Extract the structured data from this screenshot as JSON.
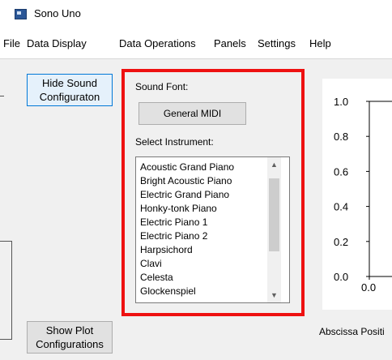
{
  "window": {
    "title": "Sono Uno"
  },
  "menu": [
    "File",
    "Data Display",
    "Data Operations",
    "Panels",
    "Settings",
    "Help"
  ],
  "buttons": {
    "hide_sound": "Hide Sound Configuraton",
    "show_plot": "Show Plot Configurations"
  },
  "sound_panel": {
    "font_label": "Sound Font:",
    "font_value": "General MIDI",
    "instrument_label": "Select Instrument:",
    "instruments": [
      "Acoustic Grand Piano",
      "Bright Acoustic Piano",
      "Electric Grand Piano",
      "Honky-tonk Piano",
      "Electric Piano 1",
      "Electric Piano 2",
      "Harpsichord",
      "Clavi",
      "Celesta",
      "Glockenspiel"
    ]
  },
  "chart_data": {
    "type": "line",
    "x_ticks": [
      "0.0"
    ],
    "y_ticks": [
      "1.0",
      "0.8",
      "0.6",
      "0.4",
      "0.2",
      "0.0"
    ],
    "xlabel": "Abscissa Positi",
    "ylim": [
      0,
      1
    ]
  },
  "colors": {
    "highlight_border": "#ee1111",
    "focus_border": "#0078d7"
  }
}
